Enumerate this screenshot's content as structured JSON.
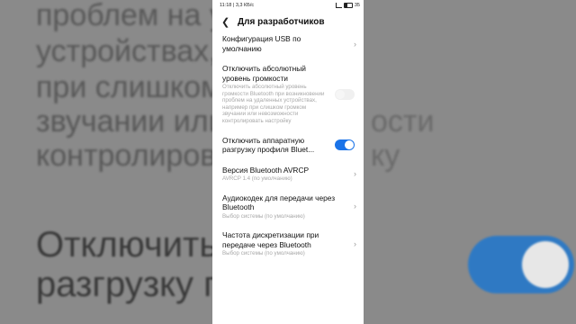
{
  "background": {
    "lines": [
      "проблем на уда",
      "устройствах, н",
      "при слишком",
      "звучании или",
      "контролирова"
    ],
    "right_fragments": [
      "ости",
      "ку"
    ],
    "big_lines": [
      "Отключить ап      ную",
      "разгрузку пр      uet..."
    ]
  },
  "status_bar": {
    "time": "11:18 | 3,3 КБ/с",
    "battery": "35"
  },
  "header": {
    "back_icon": "arrow-left-icon",
    "title": "Для разработчиков"
  },
  "settings": [
    {
      "title": "Конфигурация USB по умолчанию",
      "control": "chevron"
    },
    {
      "title": "Отключить абсолютный уровень громкости",
      "subtitle": "Отключить абсолютный уровень громкости Bluetooth при возникновении проблем на удаленных устройствах, например при слишком громком звучании или невозможности контролировать настройку",
      "control": "switch",
      "value": "off"
    },
    {
      "title": "Отключить аппаратную разгрузку профиля Bluet...",
      "control": "switch",
      "value": "on"
    },
    {
      "title": "Версия Bluetooth AVRCP",
      "subtitle": "AVRCP 1.4 (по умолчанию)",
      "control": "chevron"
    },
    {
      "title": "Аудиокодек для передачи через Bluetooth",
      "subtitle": "Выбор системы (по умолчанию)",
      "control": "chevron"
    },
    {
      "title": "Частота дискретизации при передаче через Bluetooth",
      "subtitle": "Выбор системы (по умолчанию)",
      "control": "chevron"
    }
  ],
  "colors": {
    "switch_on": "#1a73e8",
    "subtitle": "#a8a8a8"
  }
}
